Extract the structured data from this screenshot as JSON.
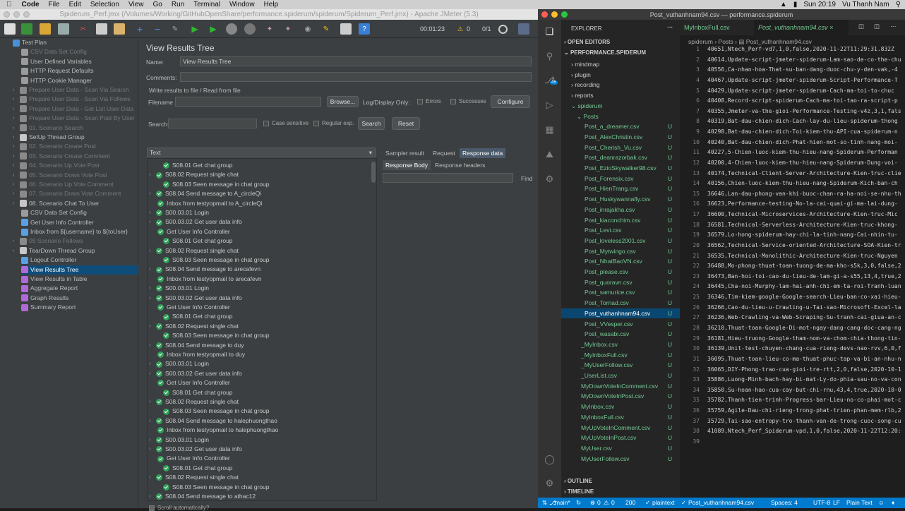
{
  "menubar": {
    "app": "Code",
    "items": [
      "File",
      "Edit",
      "Selection",
      "View",
      "Go",
      "Run",
      "Terminal",
      "Window",
      "Help"
    ],
    "clock": "Sun 20:19",
    "user": "Vu Thanh Nam"
  },
  "jmeter": {
    "window_title": "Spiderum_Perf.jmx (/Volumes/Working/GitHubOpenShare/performance.spiderum/spiderum/Spiderum_Perf.jmx) - Apache JMeter (5.3)",
    "timer": "00:01:23",
    "warn_count": "0",
    "threads": "0/1",
    "tree": [
      {
        "label": "Test Plan",
        "x": 8,
        "y": 0,
        "dis": false,
        "color": "#4a90d9"
      },
      {
        "label": "CSV Data Set Config",
        "x": 30,
        "y": 1,
        "dis": true,
        "color": "#9b9b9b"
      },
      {
        "label": "User Defined Variables",
        "x": 30,
        "y": 2,
        "dis": false,
        "color": "#9b9b9b"
      },
      {
        "label": "HTTP Request Defaults",
        "x": 30,
        "y": 3,
        "dis": false,
        "color": "#9b9b9b"
      },
      {
        "label": "HTTP Cookie Manager",
        "x": 30,
        "y": 4,
        "dis": false,
        "color": "#9b9b9b"
      },
      {
        "label": "Prepare User Data - Scan Via Search",
        "x": 18,
        "y": 5,
        "dis": true,
        "color": "#8a8a8a"
      },
      {
        "label": "Prepare User Data - Scan Via Follows",
        "x": 18,
        "y": 6,
        "dis": true,
        "color": "#8a8a8a"
      },
      {
        "label": "Prepare User Data - Get List User Data",
        "x": 18,
        "y": 7,
        "dis": true,
        "color": "#8a8a8a"
      },
      {
        "label": "Prepare User Data - Scan Post By User",
        "x": 18,
        "y": 8,
        "dis": true,
        "color": "#8a8a8a"
      },
      {
        "label": "01. Scenario Search",
        "x": 18,
        "y": 9,
        "dis": true,
        "color": "#8a8a8a"
      },
      {
        "label": "SetUp Thread Group",
        "x": 18,
        "y": 10,
        "dis": false,
        "color": "#c7c7c7"
      },
      {
        "label": "02. Scenario Create Post",
        "x": 18,
        "y": 11,
        "dis": true,
        "color": "#8a8a8a"
      },
      {
        "label": "03. Scenario Create Comment",
        "x": 18,
        "y": 12,
        "dis": true,
        "color": "#8a8a8a"
      },
      {
        "label": "04. Scenario Up Vote Post",
        "x": 18,
        "y": 13,
        "dis": true,
        "color": "#8a8a8a"
      },
      {
        "label": "05. Scenario Down Vote Post",
        "x": 18,
        "y": 14,
        "dis": true,
        "color": "#8a8a8a"
      },
      {
        "label": "06. Scenario Up Vote Comment",
        "x": 18,
        "y": 15,
        "dis": true,
        "color": "#8a8a8a"
      },
      {
        "label": "07. Scenario Down Vote Comment",
        "x": 18,
        "y": 16,
        "dis": true,
        "color": "#8a8a8a"
      },
      {
        "label": "08. Scenario Chat To User",
        "x": 18,
        "y": 17,
        "dis": false,
        "color": "#c7c7c7"
      },
      {
        "label": "CSV Data Set Config",
        "x": 30,
        "y": 18,
        "dis": false,
        "color": "#9b9b9b"
      },
      {
        "label": "Get User Info Controller",
        "x": 30,
        "y": 19,
        "dis": false,
        "color": "#5aa0e0"
      },
      {
        "label": "Inbox from ${username} to ${toUser}",
        "x": 30,
        "y": 20,
        "dis": false,
        "color": "#5aa0e0"
      },
      {
        "label": "09 Scenario Follows",
        "x": 18,
        "y": 21,
        "dis": true,
        "color": "#8a8a8a"
      },
      {
        "label": "TearDown Thread Group",
        "x": 18,
        "y": 22,
        "dis": false,
        "color": "#c7c7c7"
      },
      {
        "label": "Logout Controller",
        "x": 30,
        "y": 23,
        "dis": false,
        "color": "#5aa0e0"
      },
      {
        "label": "View Results Tree",
        "x": 30,
        "y": 24,
        "dis": false,
        "color": "#b06ad8",
        "sel": true
      },
      {
        "label": "View Results in Table",
        "x": 30,
        "y": 25,
        "dis": false,
        "color": "#b06ad8"
      },
      {
        "label": "Aggregate Report",
        "x": 30,
        "y": 26,
        "dis": false,
        "color": "#b06ad8"
      },
      {
        "label": "Graph Results",
        "x": 30,
        "y": 27,
        "dis": false,
        "color": "#b06ad8"
      },
      {
        "label": "Summary Report",
        "x": 30,
        "y": 28,
        "dis": false,
        "color": "#b06ad8"
      }
    ],
    "panel": {
      "title": "View Results Tree",
      "name_label": "Name:",
      "name_value": "View Results Tree",
      "comments_label": "Comments:",
      "write_label": "Write results to file / Read from file",
      "filename_label": "Filename",
      "browse": "Browse...",
      "logdisplay": "Log/Display Only:",
      "errors": "Errors",
      "successes": "Successes",
      "configure": "Configure",
      "search_label": "Search:",
      "case_sensitive": "Case sensitive",
      "regular_exp": "Regular exp.",
      "search_btn": "Search",
      "reset_btn": "Reset",
      "renderer": "Text",
      "tabs": [
        "Sampler result",
        "Request",
        "Response data"
      ],
      "subtabs": [
        "Response Body",
        "Response headers"
      ],
      "find": "Find",
      "scroll": "Scroll automatically?"
    },
    "samples": [
      "S08.01 Get chat group",
      "S08.02 Request single chat",
      "S08.03 Seen message in chat group",
      "S08.04 Send message to A_circleQi",
      "Inbox from testyopmail to A_circleQi",
      "S00.03.01 Login",
      "S00.03.02 Get user data info",
      "Get User Info Controller",
      "S08.01 Get chat group",
      "S08.02 Request single chat",
      "S08.03 Seen message in chat group",
      "S08.04 Send message to arecafevn",
      "Inbox from testyopmail to arecafevn",
      "S00.03.01 Login",
      "S00.03.02 Get user data info",
      "Get User Info Controller",
      "S08.01 Get chat group",
      "S08.02 Request single chat",
      "S08.03 Seen message in chat group",
      "S08.04 Send message to duy",
      "Inbox from testyopmail to duy",
      "S00.03.01 Login",
      "S00.03.02 Get user data info",
      "Get User Info Controller",
      "S08.01 Get chat group",
      "S08.02 Request single chat",
      "S08.03 Seen message in chat group",
      "S08.04 Send message to halephuongthao",
      "Inbox from testyopmail to halephuongthao",
      "S00.03.01 Login",
      "S00.03.02 Get user data info",
      "Get User Info Controller",
      "S08.01 Get chat group",
      "S08.02 Request single chat",
      "S08.03 Seen message in chat group",
      "S08.04 Send message to athac12"
    ],
    "sample_indent": [
      1,
      0,
      1,
      0,
      2,
      0,
      0,
      2,
      1,
      0,
      1,
      0,
      2,
      0,
      0,
      2,
      1,
      0,
      1,
      0,
      2,
      0,
      0,
      2,
      1,
      0,
      1,
      0,
      2,
      0,
      0,
      2,
      1,
      0,
      1,
      0
    ]
  },
  "vscode": {
    "window_title": "Post_vuthanhnam94.csv — performance.spiderum",
    "explorer": "EXPLORER",
    "open_editors": "OPEN EDITORS",
    "project": "PERFORMANCE.SPIDERUM",
    "folders": [
      "mindmap",
      "plugin",
      "recording",
      "reports",
      "spiderum",
      "Posts"
    ],
    "post_files": [
      "Post_a_dreamer.csv",
      "Post_AlexChristin.csv",
      "Post_Cherish_Vu.csv",
      "Post_deanrazorbak.csv",
      "Post_EzioSkywalker98.csv",
      "Post_Forensix.csv",
      "Post_HienTrang.csv",
      "Post_Huskywannafly.csv",
      "Post_inrajakha.csv",
      "Post_kiaconchim.csv",
      "Post_Levi.csv",
      "Post_loveless2001.csv",
      "Post_Mytwingo.csv",
      "Post_NhatBaoVN.csv",
      "Post_please.csv",
      "Post_quoravn.csv",
      "Post_samurice.csv",
      "Post_Tornad.csv",
      "Post_vuthanhnam94.csv",
      "Post_VVesper.csv",
      "Post_wasabi.csv"
    ],
    "other_files": [
      "_MyInbox.csv",
      "_MyInboxFull.csv",
      "_MyUserFollow.csv",
      "_UserList.csv",
      "MyDownVoteInComment.csv",
      "MyDownVoteInPost.csv",
      "MyInbox.csv",
      "MyInboxFull.csv",
      "MyUpVoteInComment.csv",
      "MyUpVoteInPost.csv",
      "MyUser.csv",
      "MyUserFollow.csv"
    ],
    "u": "U",
    "bottom": [
      "OUTLINE",
      "TIMELINE",
      "NPM SCRIPTS"
    ],
    "tabs": [
      "MyInboxFull.csv",
      "Post_vuthanhnam94.csv"
    ],
    "breadcrumb": [
      "spiderum",
      "Posts",
      "Post_vuthanhnam94.csv"
    ],
    "scm_badge": "45",
    "lines": [
      "40651,Ntech_Perf-vd7,1,0,false,2020-11-22T11:29:31.832Z",
      "40614,Update-script-jmeter-spiderum-Lam-sao-de-co-the-chu",
      "40556,Ca-nhan-hoa-That-su-ban-dang-duoc-chu-y-den-vak,-4",
      "40467,Update-script-jmeter-spiderum-Script-Performance-T",
      "40429,Update-script-jmeter-spiderum-Cach-ma-toi-to-chuc",
      "40408,Record-script-spiderum-Cach-ma-toi-tao-ra-script-p",
      "40355,Jmeter-va-the-gioi-Performance-Testing-v4z,3,1,fals",
      "40319,Bat-dau-chien-dich-Cach-lay-du-lieu-spiderum-thong",
      "40298,Bat-dau-chien-dich-Toi-kiem-thu-API-cua-spiderum-n",
      "40240,Bat-dau-chien-dich-Phat-hien-mot-so-tinh-nang-moi-",
      "40227,5-Chien-luoc-kiem-thu-hieu-nang-Spiderum-Performan",
      "40200,4-Chien-luoc-kiem-thu-hieu-nang-Spiderum-Dung-voi-",
      "40174,Technical-Client-Server-Architecture-Kien-truc-clie",
      "40156,Chien-luoc-kiem-thu-hieu-nang-Spiderum-Kich-ban-ch",
      "36646,Lan-dau-phong-van-khi-buoc-chan-ra-ha-noi-se-nhu-th",
      "36623,Performance-testing-No-la-cai-quai-gi-ma-lai-dung-",
      "36600,Technical-Microservices-Architecture-Kien-truc-Mic",
      "36581,Technical-Serverless-Architecture-Kien-truc-khong-",
      "36579,Lo-hong-spiderum-hay-chi-la-tinh-nang-Cai-nhin-tu-",
      "36562,Technical-Service-oriented-Architecture-SOA-Kien-tr",
      "36535,Technical-Monolithic-Architecture-Kien-truc-Nguyen",
      "36488,Mo-phong-thuat-toan-tuong-de-ma-kho-s5k,3,0,false,2",
      "36473,Ban-hoi-toi-cao-du-lieu-de-lam-gi-a-s55,13,4,true,2",
      "36445,Cha-noi-Murphy-lam-hai-anh-chi-em-ta-roi-Tranh-luan",
      "36346,Tim-kiem-google-Google-search-Lieu-ban-co-xai-hieu-",
      "36266,Cao-du-lieu-u-Crawling-u-Tai-sao-Microsoft-Excel-la",
      "36236,Web-Crawling-va-Web-Scraping-Su-tranh-cai-giua-an-c",
      "36210,Thuat-toan-Google-Di-mot-ngay-dang-cang-doc-cang-ng",
      "36181,Hieu-truong-Google-tham-nom-va-chom-chia-thong-tin-",
      "36139,Unit-test-chuyen-chang-cua-rieng-devs-nao-rvv,6,0,f",
      "36095,Thuat-toan-lieu-co-ma-thuat-phuc-tap-va-bi-an-nhu-n",
      "36065,DIY-Phong-trao-cua-gioi-tre-rtt,2,0,false,2020-10-1",
      "35886,Luong-Minh-bach-hay-bi-mat-Ly-do-phia-sau-no-va-con",
      "35850,Su-hoan-hao-cua-cay-but-chi-rnu,43,4,true,2020-10-0",
      "35782,Thanh-tien-trinh-Progress-bar-Lieu-no-co-phai-mot-c",
      "35759,Agile-Dau-chi-rieng-trong-phat-trien-phan-mem-rlb,2",
      "35729,Tai-sao-entropy-tro-thanh-van-de-trong-cuoc-song-cu",
      "41089,Ntech_Perf_Spiderum-vpd,1,0,false,2020-11-22T12:20:"
    ],
    "status": {
      "branch": "main*",
      "errors": "0",
      "warnings": "0",
      "ports": "200",
      "plaintext": "plaintext",
      "file": "Post_vuthanhnam94.csv",
      "spaces": "Spaces: 4",
      "enc": "UTF-8",
      "eol": "LF",
      "lang": "Plain Text"
    }
  }
}
